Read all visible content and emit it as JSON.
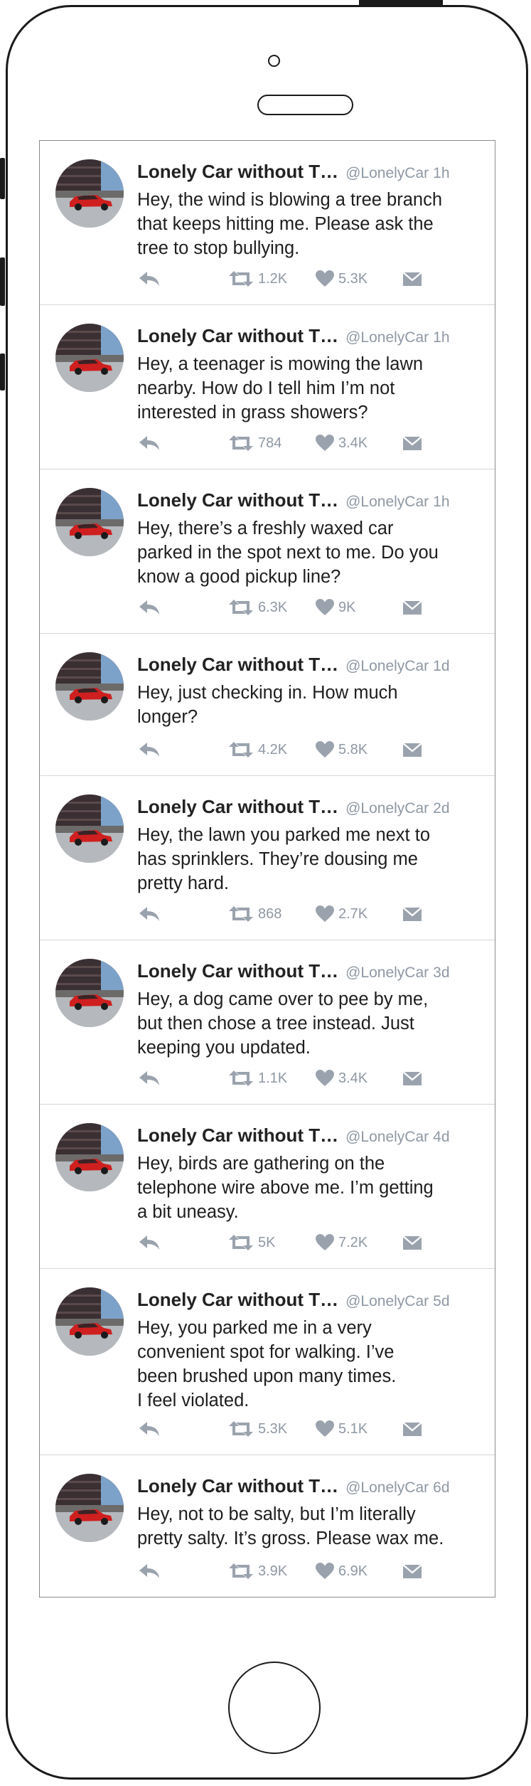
{
  "account": {
    "name": "Lonely Car without T…",
    "handle": "@LonelyCar"
  },
  "colors": {
    "icon_gray": "#9aa3ad",
    "text": "#1e1e1e",
    "meta": "#8f98a3",
    "divider": "#d7d7d7"
  },
  "icons": [
    "reply-icon",
    "retweet-icon",
    "heart-icon",
    "direct-message-icon"
  ],
  "tweets": [
    {
      "age": "1h",
      "text": "Hey, the wind is blowing a tree branch\nthat keeps hitting me. Please ask the\ntree to stop bullying.",
      "retweets": "1.2K",
      "likes": "5.3K"
    },
    {
      "age": "1h",
      "text": "Hey, a teenager is mowing the lawn\nnearby. How do I tell him I’m not\ninterested in grass showers?",
      "retweets": "784",
      "likes": "3.4K"
    },
    {
      "age": "1h",
      "text": "Hey, there’s a freshly waxed car\nparked in the spot next to me. Do you\nknow a good pickup line?",
      "retweets": "6.3K",
      "likes": "9K"
    },
    {
      "age": "1d",
      "text": "Hey, just checking in. How much\nlonger?",
      "retweets": "4.2K",
      "likes": "5.8K"
    },
    {
      "age": "2d",
      "text": "Hey, the lawn you parked me next to\nhas sprinklers. They’re dousing me\npretty hard.",
      "retweets": "868",
      "likes": "2.7K"
    },
    {
      "age": "3d",
      "text": "Hey, a dog came over to pee by me,\nbut then chose a tree instead. Just\nkeeping you updated.",
      "retweets": "1.1K",
      "likes": "3.4K"
    },
    {
      "age": "4d",
      "text": "Hey, birds are gathering on the\ntelephone wire above me. I’m getting\na bit uneasy.",
      "retweets": "5K",
      "likes": "7.2K"
    },
    {
      "age": "5d",
      "text": "Hey, you parked me in a very\nconvenient spot for walking. I’ve\nbeen brushed upon many times.\nI feel violated.",
      "retweets": "5.3K",
      "likes": "5.1K"
    },
    {
      "age": "6d",
      "text": "Hey, not to be salty, but I’m literally\npretty salty. It’s gross. Please wax me.",
      "retweets": "3.9K",
      "likes": "6.9K"
    }
  ]
}
